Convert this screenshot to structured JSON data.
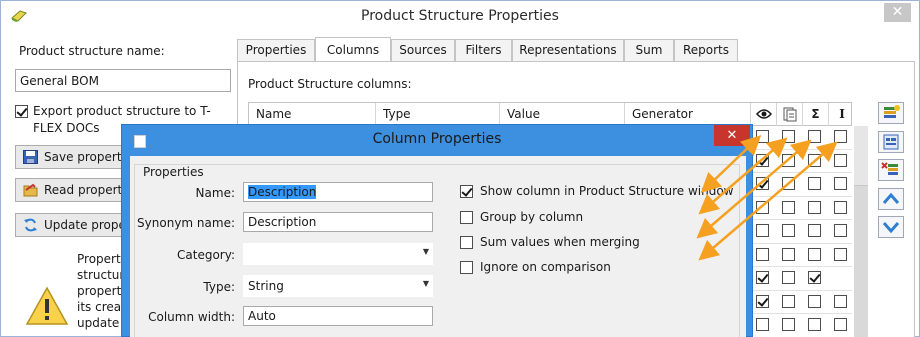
{
  "main_window": {
    "title": "Product Structure Properties",
    "close_label": "✕"
  },
  "left_panel": {
    "name_label": "Product structure name:",
    "name_value": "General BOM",
    "export_label": "Export product structure to T-FLEX DOCs",
    "export_checked": true,
    "buttons": [
      {
        "label": "Save properties",
        "icon": "floppy-icon"
      },
      {
        "label": "Read properties",
        "icon": "open-folder-icon"
      },
      {
        "label": "Update properties",
        "icon": "refresh-icon"
      }
    ],
    "info_lines": [
      "Properties of product",
      "structure are the",
      "properties set at",
      "its creation. To",
      "update properties"
    ],
    "warning_icon": "warning-icon"
  },
  "tabs": [
    "Properties",
    "Columns",
    "Sources",
    "Filters",
    "Representations",
    "Sum",
    "Reports"
  ],
  "active_tab": "Columns",
  "columns_tab": {
    "label": "Product Structure columns:",
    "headers": [
      "Name",
      "Type",
      "Value",
      "Generator"
    ],
    "icon_headers": [
      {
        "name": "eye-icon",
        "glyph": "👁"
      },
      {
        "name": "document-pages-icon",
        "glyph": ""
      },
      {
        "name": "sigma-icon",
        "glyph": "Σ"
      },
      {
        "name": "italic-i-icon",
        "glyph": "I"
      }
    ],
    "rows": [
      [
        false,
        false,
        false,
        false
      ],
      [
        true,
        false,
        false,
        false
      ],
      [
        true,
        false,
        false,
        false
      ],
      [
        false,
        false,
        false,
        false
      ],
      [
        false,
        false,
        false,
        false
      ],
      [
        false,
        false,
        false,
        false
      ],
      [
        true,
        false,
        true,
        null
      ],
      [
        true,
        false,
        false,
        false
      ],
      [
        false,
        false,
        false,
        false
      ]
    ]
  },
  "toolbar": [
    {
      "name": "add-column-button",
      "icon": "add-column-icon"
    },
    {
      "name": "column-properties-button",
      "icon": "properties-icon"
    },
    {
      "name": "delete-column-button",
      "icon": "delete-column-icon"
    },
    {
      "name": "move-up-button",
      "icon": "arrow-up-icon"
    },
    {
      "name": "move-down-button",
      "icon": "arrow-down-icon"
    }
  ],
  "dialog": {
    "title": "Column Properties",
    "close_label": "✕",
    "group_label": "Properties",
    "fields": {
      "name_label": "Name:",
      "name_value": "Description",
      "synonym_label": "Synonym name:",
      "synonym_value": "Description",
      "category_label": "Category:",
      "category_value": "",
      "type_label": "Type:",
      "type_value": "String",
      "width_label": "Column width:",
      "width_value": "Auto"
    },
    "options": [
      {
        "label": "Show column in Product Structure window",
        "checked": true
      },
      {
        "label": "Group by column",
        "checked": false
      },
      {
        "label": "Sum values when merging",
        "checked": false
      },
      {
        "label": "Ignore on comparison",
        "checked": false
      }
    ]
  },
  "colors": {
    "dialog_border": "#3d8fe0",
    "close_red": "#c7352d",
    "arrow_orange": "#f5a020",
    "selection_blue": "#3399ff"
  }
}
